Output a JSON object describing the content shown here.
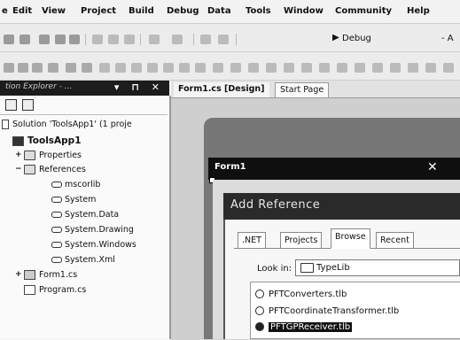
{
  "menu": {
    "items": [
      "e",
      "Edit",
      "View",
      "Project",
      "Build",
      "Debug",
      "Data",
      "Tools",
      "Window",
      "Community",
      "Help"
    ]
  },
  "toolbar": {
    "config_value": "Debug",
    "platform_value": "- A"
  },
  "solution_explorer": {
    "title": "tion Explorer - ...",
    "controls": "▾ ⊓ ✕",
    "tree": {
      "solution": "Solution 'ToolsApp1' (1 proje",
      "project": "ToolsApp1",
      "properties": "Properties",
      "references": "References",
      "refs": [
        "mscorlib",
        "System",
        "System.Data",
        "System.Drawing",
        "System.Windows",
        "System.Xml"
      ],
      "form1": "Form1.cs",
      "program": "Program.cs"
    }
  },
  "doc_tabs": {
    "form_design": "Form1.cs [Design]",
    "start_page": "Start Page"
  },
  "form": {
    "title": "Form1",
    "close": "✕"
  },
  "add_reference": {
    "title": "Add Reference",
    "tabs": [
      ".NET",
      "Projects",
      "Browse",
      "Recent"
    ],
    "look_in_label": "Look in:",
    "look_in_value": "TypeLib",
    "files": [
      "PFTConverters.tlb",
      "PFTCoordinateTransformer.tlb",
      "PFTGPReceiver.tlb"
    ]
  }
}
